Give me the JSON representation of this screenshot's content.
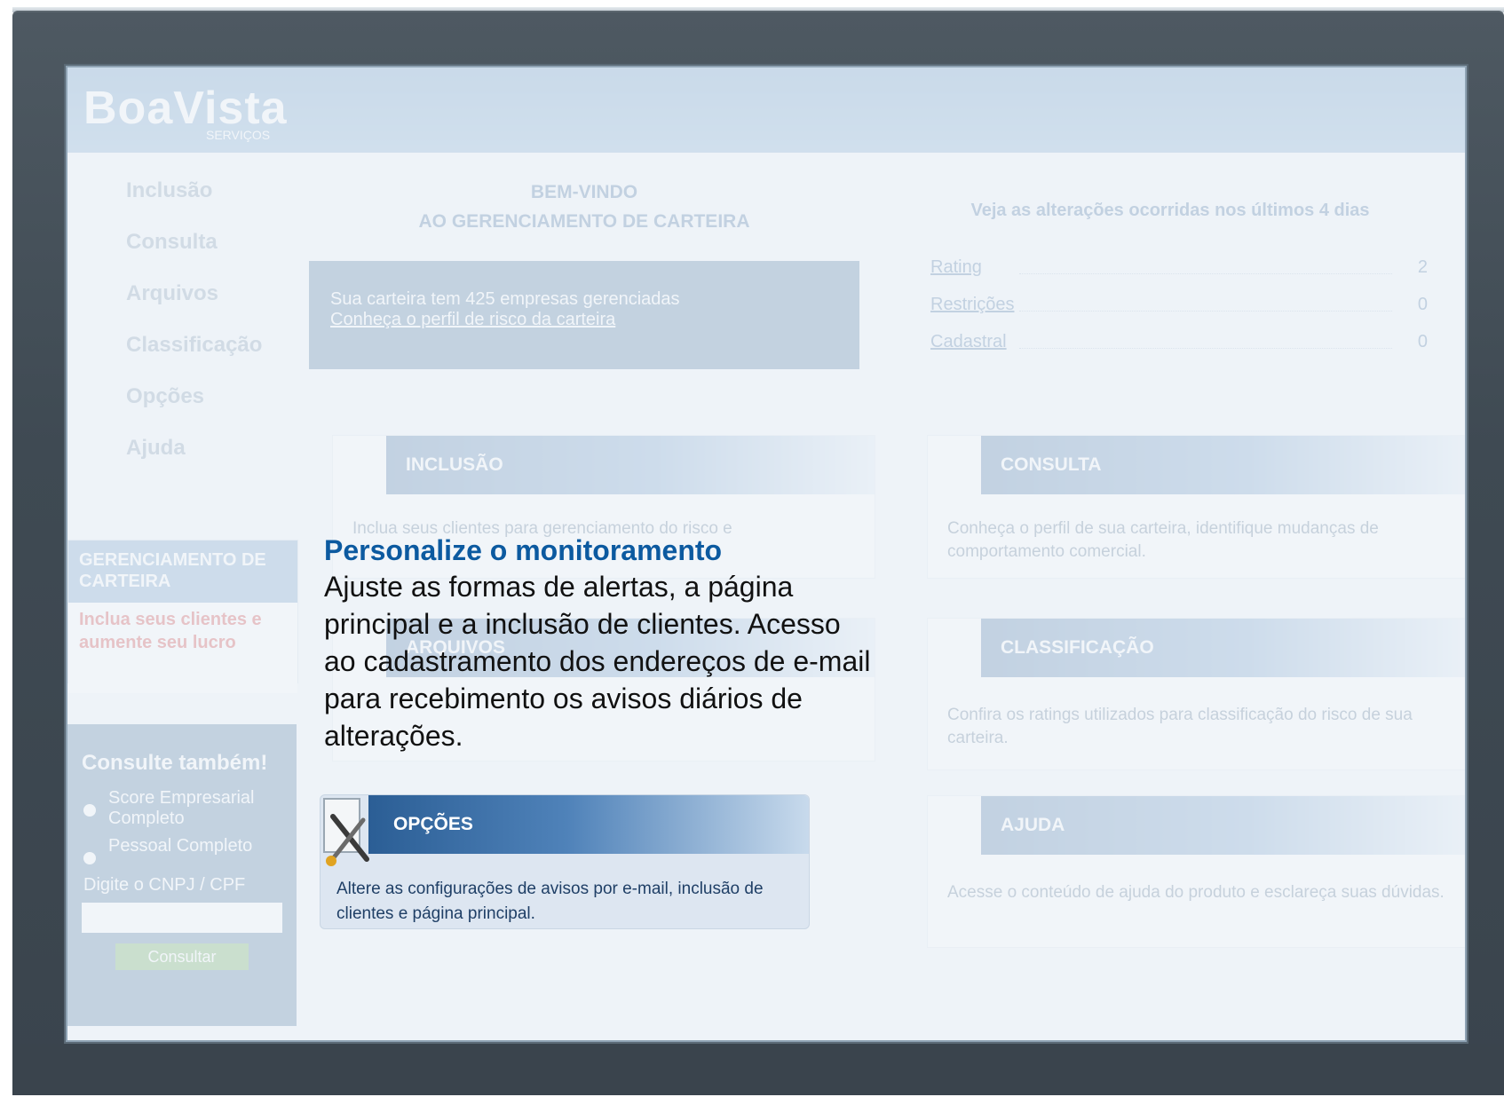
{
  "app": {
    "logo": "BoaVista",
    "logo_sub": "SERVIÇOS"
  },
  "nav": {
    "items": [
      "Inclusão",
      "Consulta",
      "Arquivos",
      "Classificação",
      "Opções",
      "Ajuda"
    ]
  },
  "sidebar": {
    "box1_title": "GERENCIAMENTO DE CARTEIRA",
    "box1_body": "Inclua seus clientes e aumente seu lucro",
    "box2_title": "Consulte também!",
    "option1": "Score Empresarial Completo",
    "option2": "Pessoal Completo",
    "cnpj_label": "Digite o CNPJ / CPF",
    "button": "Consultar"
  },
  "welcome": {
    "line1": "BEM-VINDO",
    "line2": "AO GERENCIAMENTO DE CARTEIRA",
    "box_text": "Sua carteira tem 425 empresas gerenciadas",
    "box_link": "Conheça o perfil de risco da carteira"
  },
  "changes": {
    "title": "Veja as alterações ocorridas nos últimos 4 dias",
    "rows": [
      {
        "label": "Rating",
        "value": "2"
      },
      {
        "label": "Restrições",
        "value": "0"
      },
      {
        "label": "Cadastral",
        "value": "0"
      }
    ]
  },
  "cards": {
    "inclusao": {
      "title": "INCLUSÃO",
      "text": "Inclua seus clientes para gerenciamento do risco e"
    },
    "consulta": {
      "title": "CONSULTA",
      "text": "Conheça o perfil de sua carteira, identifique mudanças de comportamento comercial."
    },
    "arquivos": {
      "title": "ARQUIVOS",
      "text": ""
    },
    "classificacao": {
      "title": "CLASSIFICAÇÃO",
      "text": "Confira os ratings utilizados para classificação do risco de sua carteira."
    },
    "opcoes": {
      "title": "OPÇÕES",
      "text": "Altere as configurações de avisos por e-mail, inclusão de clientes e página principal."
    },
    "ajuda": {
      "title": "AJUDA",
      "text": "Acesse o conteúdo de ajuda do produto e esclareça suas dúvidas."
    }
  },
  "tooltip": {
    "title": "Personalize o monitoramento",
    "body": "Ajuste as formas de alertas, a página principal e a inclusão de clientes. Acesso ao cadastramento dos endereços de e-mail para recebimento os avisos diários de alterações."
  },
  "colors": {
    "bezel": "#3f4a53",
    "accent": "#0c5aa0",
    "card_bar": "#2b5e95"
  }
}
